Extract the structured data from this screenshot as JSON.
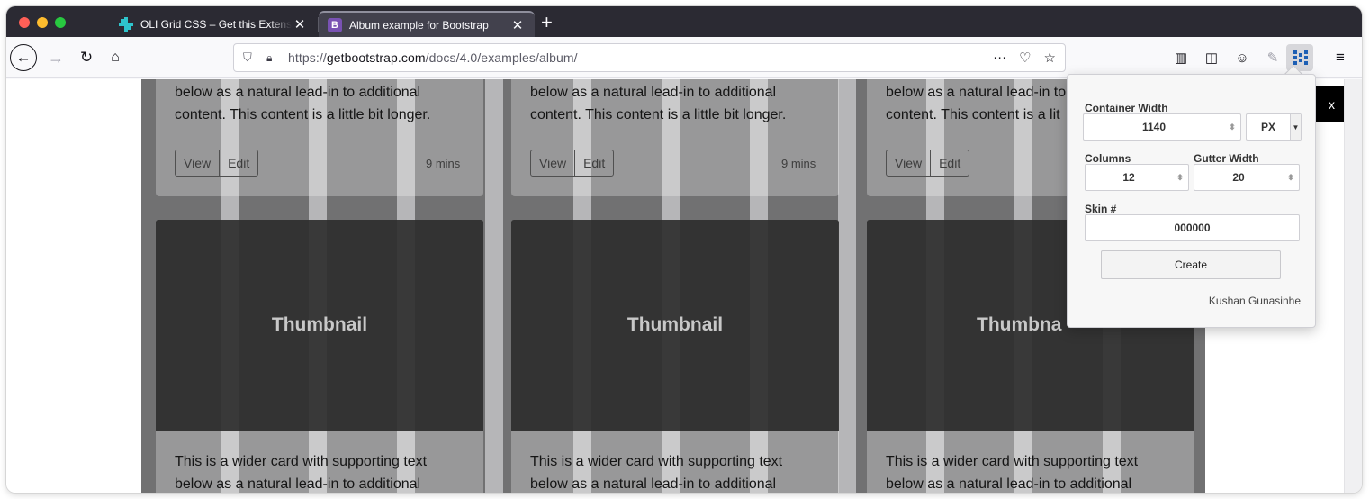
{
  "tabs": [
    {
      "title": "OLI Grid CSS – Get this Extension for Firefox",
      "active": false
    },
    {
      "title": "Album example for Bootstrap",
      "active": true
    }
  ],
  "address_bar": {
    "scheme": "https://",
    "host": "getbootstrap.com",
    "path": "/docs/4.0/examples/album/"
  },
  "cards": {
    "text_top_line1": "below as a natural lead-in to additional",
    "text_top_line2": "content. This content is a little bit longer.",
    "text_top_line2_clipped": "content. This content is a lit",
    "view_label": "View",
    "edit_label": "Edit",
    "time_label": "9 mins",
    "thumbnail_label": "Thumbnail",
    "thumbnail_label_clipped": "Thumbna",
    "text_bottom_line1": "This is a wider card with supporting text",
    "text_bottom_line2": "below as a natural lead-in to additional"
  },
  "page_fragment_close": "x",
  "popup": {
    "container_width_label": "Container Width",
    "container_width_value": "1140",
    "unit_value": "PX",
    "columns_label": "Columns",
    "columns_value": "12",
    "gutter_label": "Gutter Width",
    "gutter_value": "20",
    "skin_label": "Skin #",
    "skin_value": "000000",
    "create_label": "Create",
    "author": "Kushan Gunasinhe"
  },
  "colors": {
    "tabstrip": "#2b2a33",
    "active_tab": "#42414d",
    "bootstrap_purple": "#7952b3",
    "oli_icon": "#2ec4cc"
  },
  "icons": [
    "back-icon",
    "forward-icon",
    "reload-icon",
    "home-icon",
    "shield-icon",
    "lock-icon",
    "more-icon",
    "pocket-icon",
    "bookmark-star-icon",
    "library-icon",
    "sidebar-icon",
    "account-icon",
    "pen-icon",
    "grid-extension-icon",
    "menu-icon"
  ]
}
